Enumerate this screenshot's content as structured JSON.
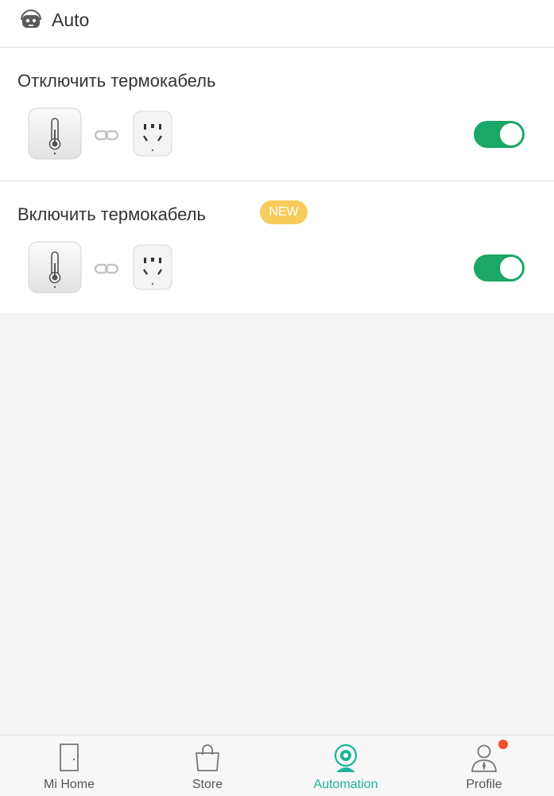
{
  "header": {
    "title": "Auto",
    "icon": "robot-icon"
  },
  "scenes": [
    {
      "name": "Отключить термокабель",
      "enabled": true,
      "trigger_device": "thermometer-sensor",
      "action_device": "smart-plug"
    },
    {
      "name": "Включить термокабель",
      "badge": "NEW",
      "enabled": true,
      "trigger_device": "thermometer-sensor",
      "action_device": "smart-plug"
    }
  ],
  "tabs": [
    {
      "label": "Mi Home",
      "icon": "door-icon"
    },
    {
      "label": "Store",
      "icon": "shopping-bag-icon"
    },
    {
      "label": "Automation",
      "icon": "automation-camera-icon",
      "active": true
    },
    {
      "label": "Profile",
      "icon": "person-icon",
      "notification": true
    }
  ],
  "colors": {
    "toggle_on": "#1ba767",
    "accent": "#1cb39a",
    "badge": "#f7cc5b",
    "notification_dot": "#f04e23"
  }
}
